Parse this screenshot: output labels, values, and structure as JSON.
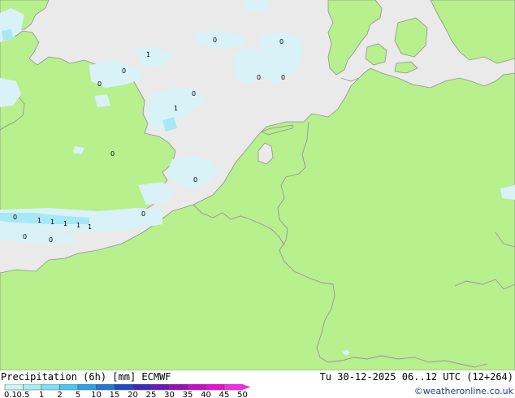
{
  "footer": {
    "title": "Precipitation (6h) [mm] ECMWF",
    "valid": "Tu 30-12-2025 06..12 UTC (12+264)",
    "credit": "©weatheronline.co.uk"
  },
  "legend": {
    "ticks": [
      "0.1",
      "0.5",
      "1",
      "2",
      "5",
      "10",
      "15",
      "20",
      "25",
      "30",
      "35",
      "40",
      "45",
      "50"
    ],
    "colors": [
      "#ccf4f4",
      "#a6ecf4",
      "#7ee0f4",
      "#4cc8f0",
      "#2ea0e6",
      "#2476d8",
      "#1a4cc8",
      "#3a2ab8",
      "#6a1ab8",
      "#9a10b8",
      "#c810c8",
      "#e810d8",
      "#f030e8"
    ]
  },
  "colors": {
    "land": "#b7f08c",
    "sea": "#eaeaea",
    "border": "#a08ca8",
    "coast": "#909090",
    "precip_light": "#d8f2f8",
    "precip_mid": "#a8e8f4"
  },
  "precip_labels": [
    "0",
    "1",
    "0",
    "0",
    "0",
    "1",
    "0",
    "0",
    "0",
    "0",
    "0",
    "0",
    "1",
    "1",
    "1",
    "1",
    "1",
    "0",
    "0",
    "0"
  ]
}
